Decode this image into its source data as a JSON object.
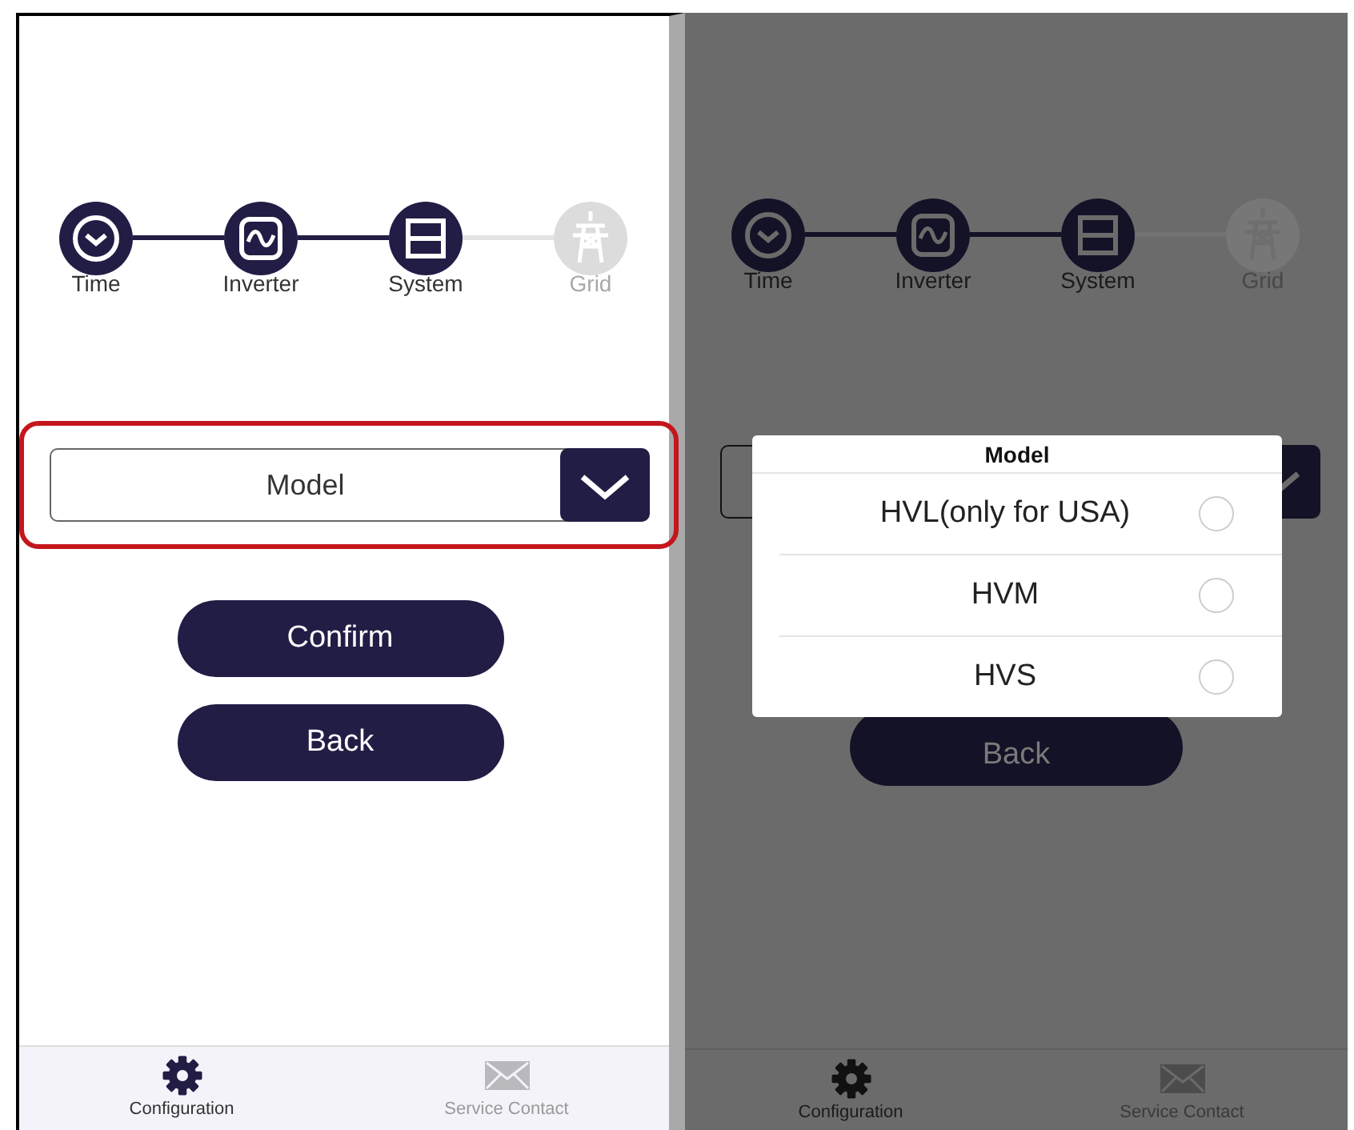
{
  "screens": [
    {
      "dimmed": false,
      "steps": [
        {
          "label": "Time",
          "done": true
        },
        {
          "label": "Inverter",
          "done": true
        },
        {
          "label": "System",
          "done": true
        },
        {
          "label": "Grid",
          "done": false
        }
      ],
      "model_field": {
        "placeholder": "Model",
        "highlighted": true
      },
      "buttons": [
        "Confirm",
        "Back"
      ],
      "tabs": [
        {
          "label": "Configuration",
          "selected": true
        },
        {
          "label": "Service Contact",
          "selected": false
        }
      ]
    },
    {
      "dimmed": true,
      "steps": [
        {
          "label": "Time",
          "done": true
        },
        {
          "label": "Inverter",
          "done": true
        },
        {
          "label": "System",
          "done": true
        },
        {
          "label": "Grid",
          "done": false
        }
      ],
      "model_field": {
        "highlighted": false
      },
      "buttons": [
        "Back"
      ],
      "tabs": [
        {
          "label": "Configuration",
          "selected": true
        },
        {
          "label": "Service Contact",
          "selected": false
        }
      ],
      "dialog": {
        "title": "Model",
        "options": [
          {
            "label": "HVL(only for USA)",
            "selected": false
          },
          {
            "label": "HVM",
            "selected": false
          },
          {
            "label": "HVS",
            "selected": false
          }
        ]
      }
    }
  ]
}
